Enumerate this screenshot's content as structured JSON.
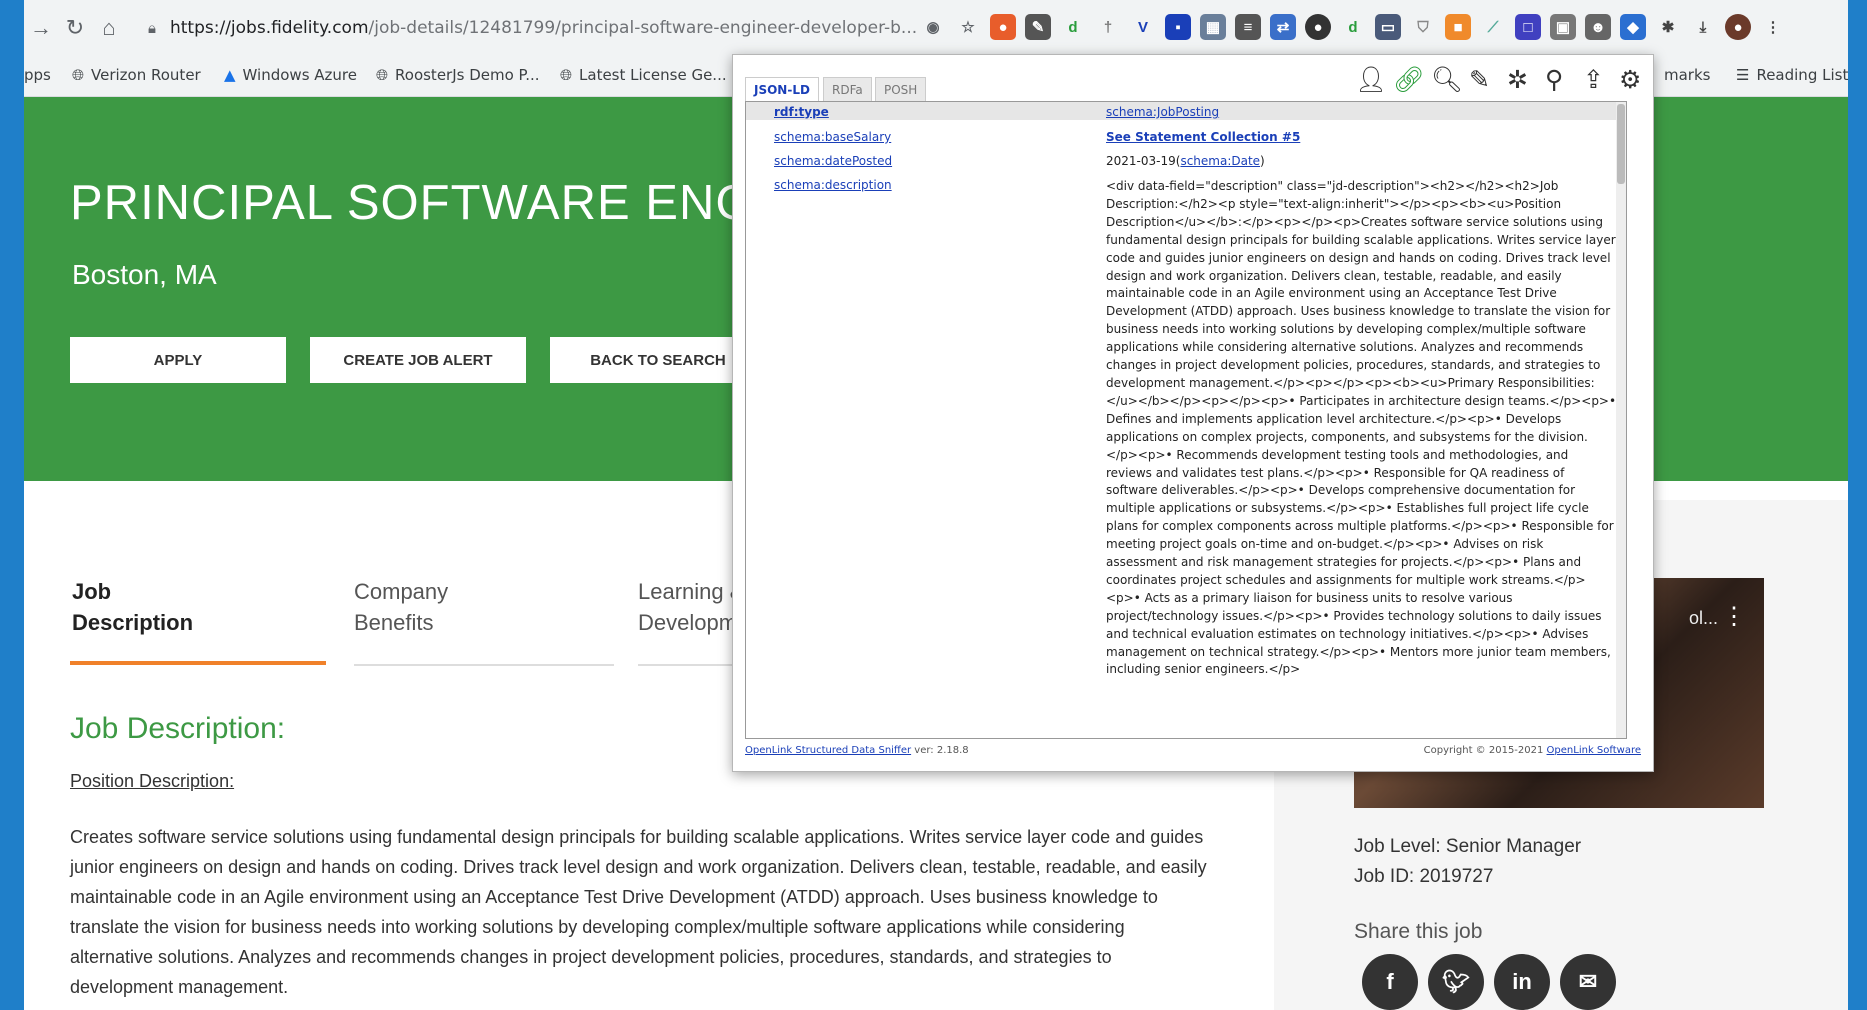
{
  "browser": {
    "url_host": "https://jobs.fidelity.com",
    "url_path": "/job-details/12481799/principal-software-engineer-developer-b...",
    "bookmarks": [
      "pps",
      "Verizon Router",
      "Windows Azure",
      "RoosterJs Demo P...",
      "Latest License Ge...",
      "marks",
      "Reading List"
    ]
  },
  "page": {
    "job_title": "PRINCIPAL SOFTWARE ENGIN",
    "location": "Boston, MA",
    "buttons": {
      "apply": "APPLY",
      "create_alert": "CREATE JOB ALERT",
      "back": "BACK TO SEARCH"
    },
    "tabs": [
      {
        "line1": "Job",
        "line2": "Description"
      },
      {
        "line1": "Company",
        "line2": "Benefits"
      },
      {
        "line1": "Learning &",
        "line2": "Developm"
      }
    ],
    "section_heading": "Job Description:",
    "position_description_label": "Position Description:",
    "body_text": "Creates software service solutions using fundamental design principals for building scalable applications. Writes service layer code and guides junior engineers on design and hands on coding. Drives track level design and work organization. Delivers clean, testable, readable, and easily maintainable code in an Agile environment using an Acceptance Test Drive Development (ATDD) approach. Uses business knowledge to translate the vision for business needs into working solutions by developing complex/multiple software applications while considering alternative solutions. Analyzes and recommends changes in project development policies, procedures, standards, and strategies to development management.",
    "job_level": "Job Level: Senior Manager",
    "job_id": "Job ID: 2019727",
    "share_label": "Share this job",
    "video_badge": "ol..."
  },
  "sniffer": {
    "tabs": [
      "JSON-LD",
      "RDFa",
      "POSH"
    ],
    "rows": [
      {
        "prop": "rdf:type",
        "value": "schema:JobPosting"
      },
      {
        "prop": "schema:baseSalary",
        "value": "See Statement Collection #5"
      },
      {
        "prop": "schema:datePosted",
        "value": "2021-03-19",
        "value_type": "schema:Date"
      },
      {
        "prop": "schema:description",
        "value": ""
      }
    ],
    "description_html": "<div data-field=\"description\" class=\"jd-description\"><h2></h2><h2>Job Description:</h2><p style=\"text-align:inherit\"></p><p><b><u>Position Description</u></b>:</p><p></p><p>Creates software service solutions using fundamental design principals for building scalable applications. Writes service layer code and guides junior engineers on design and hands on coding. Drives track level design and work organization. Delivers clean, testable, readable, and easily maintainable code in an Agile environment using an Acceptance Test Drive Development (ATDD) approach. Uses business knowledge to translate the vision for business needs into working solutions by developing complex/multiple software applications while considering alternative solutions. Analyzes and recommends changes in project development policies, procedures, standards, and strategies to development management.</p><p></p><p><b><u>Primary Responsibilities:</u></b></p><p></p><p>• Participates in architecture design teams.</p><p>• Defines and implements application level architecture.</p><p>• Develops applications on complex projects, components, and subsystems for the division.</p><p>• Recommends development testing tools and methodologies, and reviews and validates test plans.</p><p>• Responsible for QA readiness of software deliverables.</p><p>• Develops comprehensive documentation for multiple applications or subsystems.</p><p>• Establishes full project life cycle plans for complex components across multiple platforms.</p><p>• Responsible for meeting project goals on-time and on-budget.</p><p>• Advises on risk assessment and risk management strategies for projects.</p><p>• Plans and coordinates project schedules and assignments for multiple work streams.</p><p>• Acts as a primary liaison for business units to resolve various project/technology issues.</p><p>• Provides technology solutions to daily issues and technical evaluation estimates on technology initiatives.</p><p>• Advises management on technical strategy.</p><p>• Mentors more junior team members, including senior engineers.</p>",
    "footer_left_link": "OpenLink Structured Data Sniffer",
    "footer_left_version": " ver: 2.18.8",
    "footer_right_text": "Copyright © 2015-2021 ",
    "footer_right_link": "OpenLink Software"
  }
}
